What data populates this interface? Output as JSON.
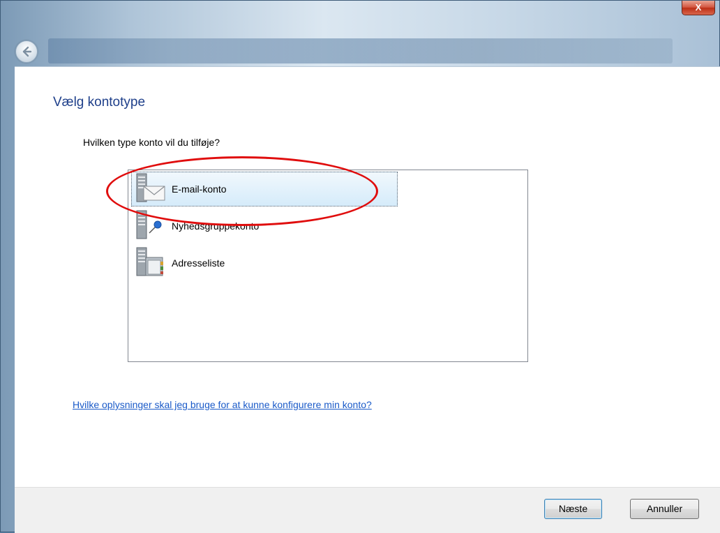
{
  "window": {
    "close_label": "X",
    "back_icon": "back-arrow-icon"
  },
  "main": {
    "title": "Vælg kontotype",
    "question": "Hvilken type konto vil du tilføje?",
    "account_types": [
      {
        "label": "E-mail-konto",
        "icon": "email-server-icon",
        "selected": true
      },
      {
        "label": "Nyhedsgruppekonto",
        "icon": "newsgroup-server-icon",
        "selected": false
      },
      {
        "label": "Adresseliste",
        "icon": "directory-server-icon",
        "selected": false
      }
    ],
    "help_link": "Hvilke oplysninger skal jeg bruge for at kunne konfigurere min konto?"
  },
  "footer": {
    "next_label": "Næste",
    "cancel_label": "Annuller"
  },
  "colors": {
    "title": "#1e3f8a",
    "link": "#1a5ac8",
    "annotation": "#e00d0d",
    "selection": "#d5ebfa"
  }
}
